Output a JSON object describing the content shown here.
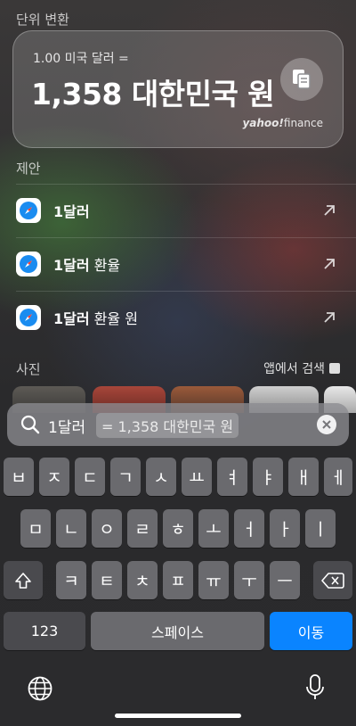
{
  "header": {
    "unit_conversion_title": "단위 변환"
  },
  "conversion": {
    "from": "1.00 미국 달러 =",
    "to": "1,358 대한민국 원",
    "source_brand": "yahoo!",
    "source_suffix": "finance",
    "icons": {
      "copy": "copy-icon"
    }
  },
  "suggestions": {
    "title": "제안",
    "items": [
      {
        "bold": "1달러",
        "rest": ""
      },
      {
        "bold": "1달러",
        "rest": " 환율"
      },
      {
        "bold": "1달러",
        "rest": " 환율 원"
      }
    ],
    "icons": {
      "app": "safari-icon",
      "arrow": "arrow-up-right-icon"
    }
  },
  "photos": {
    "title": "사진",
    "open_in_app": "앱에서 검색"
  },
  "search": {
    "query": "1달러",
    "completion": "= 1,358 대한민국 원",
    "icons": {
      "search": "search-icon",
      "clear": "clear-icon"
    }
  },
  "keyboard": {
    "row1": [
      "ㅂ",
      "ㅈ",
      "ㄷ",
      "ㄱ",
      "ㅅ",
      "ㅛ",
      "ㅕ",
      "ㅑ",
      "ㅐ",
      "ㅔ"
    ],
    "row2": [
      "ㅁ",
      "ㄴ",
      "ㅇ",
      "ㄹ",
      "ㅎ",
      "ㅗ",
      "ㅓ",
      "ㅏ",
      "ㅣ"
    ],
    "row3": [
      "ㅋ",
      "ㅌ",
      "ㅊ",
      "ㅍ",
      "ㅠ",
      "ㅜ",
      "ㅡ"
    ],
    "numbers_key": "123",
    "space_key": "스페이스",
    "return_key": "이동",
    "icons": {
      "shift": "shift-icon",
      "delete": "delete-icon",
      "globe": "globe-icon",
      "mic": "microphone-icon"
    }
  },
  "colors": {
    "accent": "#0a84ff"
  }
}
